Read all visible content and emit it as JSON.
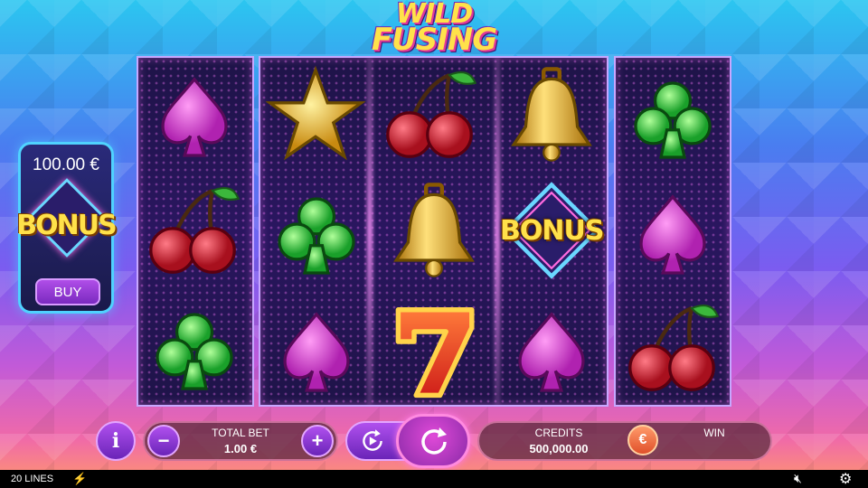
{
  "logo": {
    "line1": "WILD",
    "line2": "FUSING"
  },
  "buy_panel": {
    "price": "100.00 €",
    "bonus_label": "BONUS",
    "buy_label": "BUY"
  },
  "reels": [
    [
      "spade",
      "cherry",
      "club"
    ],
    [
      "star",
      "club",
      "spade"
    ],
    [
      "cherry",
      "bell",
      "seven"
    ],
    [
      "bell",
      "bonus",
      "spade"
    ],
    [
      "club",
      "spade",
      "cherry"
    ]
  ],
  "bonus_symbol_label": "BONUS",
  "controls": {
    "info_label": "i",
    "minus_label": "−",
    "plus_label": "+",
    "total_bet_label": "TOTAL BET",
    "total_bet_value": "1.00 €",
    "credits_label": "CREDITS",
    "credits_value": "500,000.00",
    "currency_symbol": "€",
    "win_label": "WIN"
  },
  "statusbar": {
    "lines_label": "20 LINES"
  },
  "colors": {
    "spade": "#e052d8",
    "club": "#3cdc4a",
    "cherry": "#e8283c",
    "gold": "#f4c430",
    "panel_border": "#4fd2ff"
  }
}
